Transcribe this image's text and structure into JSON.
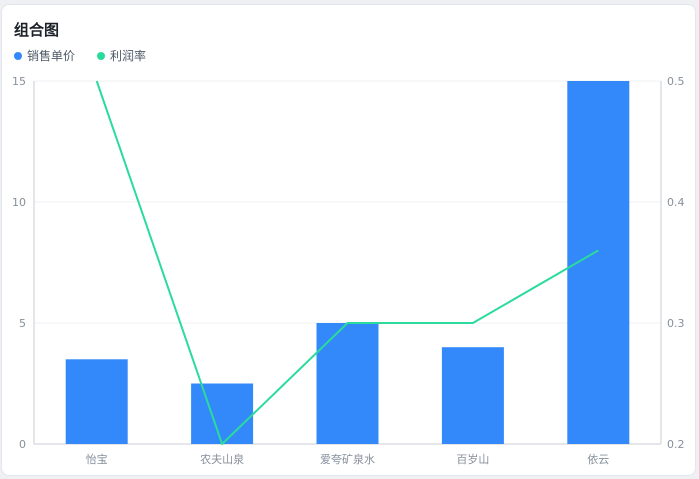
{
  "card": {
    "title": "组合图"
  },
  "chart_data": {
    "type": "bar",
    "categories": [
      "怡宝",
      "农夫山泉",
      "爱夸矿泉水",
      "百岁山",
      "依云"
    ],
    "series": [
      {
        "name": "销售单价",
        "type": "bar",
        "axis": "left",
        "color": "#3388fa",
        "values": [
          3.5,
          2.5,
          5,
          4,
          15
        ]
      },
      {
        "name": "利润率",
        "type": "line",
        "axis": "right",
        "color": "#2bdb9c",
        "values": [
          0.5,
          0.2,
          0.3,
          0.3,
          0.36
        ]
      }
    ],
    "ylim": [
      0,
      15
    ],
    "yticks": [
      "0",
      "5",
      "10",
      "15"
    ],
    "ylim_right": [
      0.2,
      0.5
    ],
    "yticks_right": [
      "0.2",
      "0.3",
      "0.4",
      "0.5"
    ],
    "grid": true,
    "legend_position": "top-left"
  }
}
